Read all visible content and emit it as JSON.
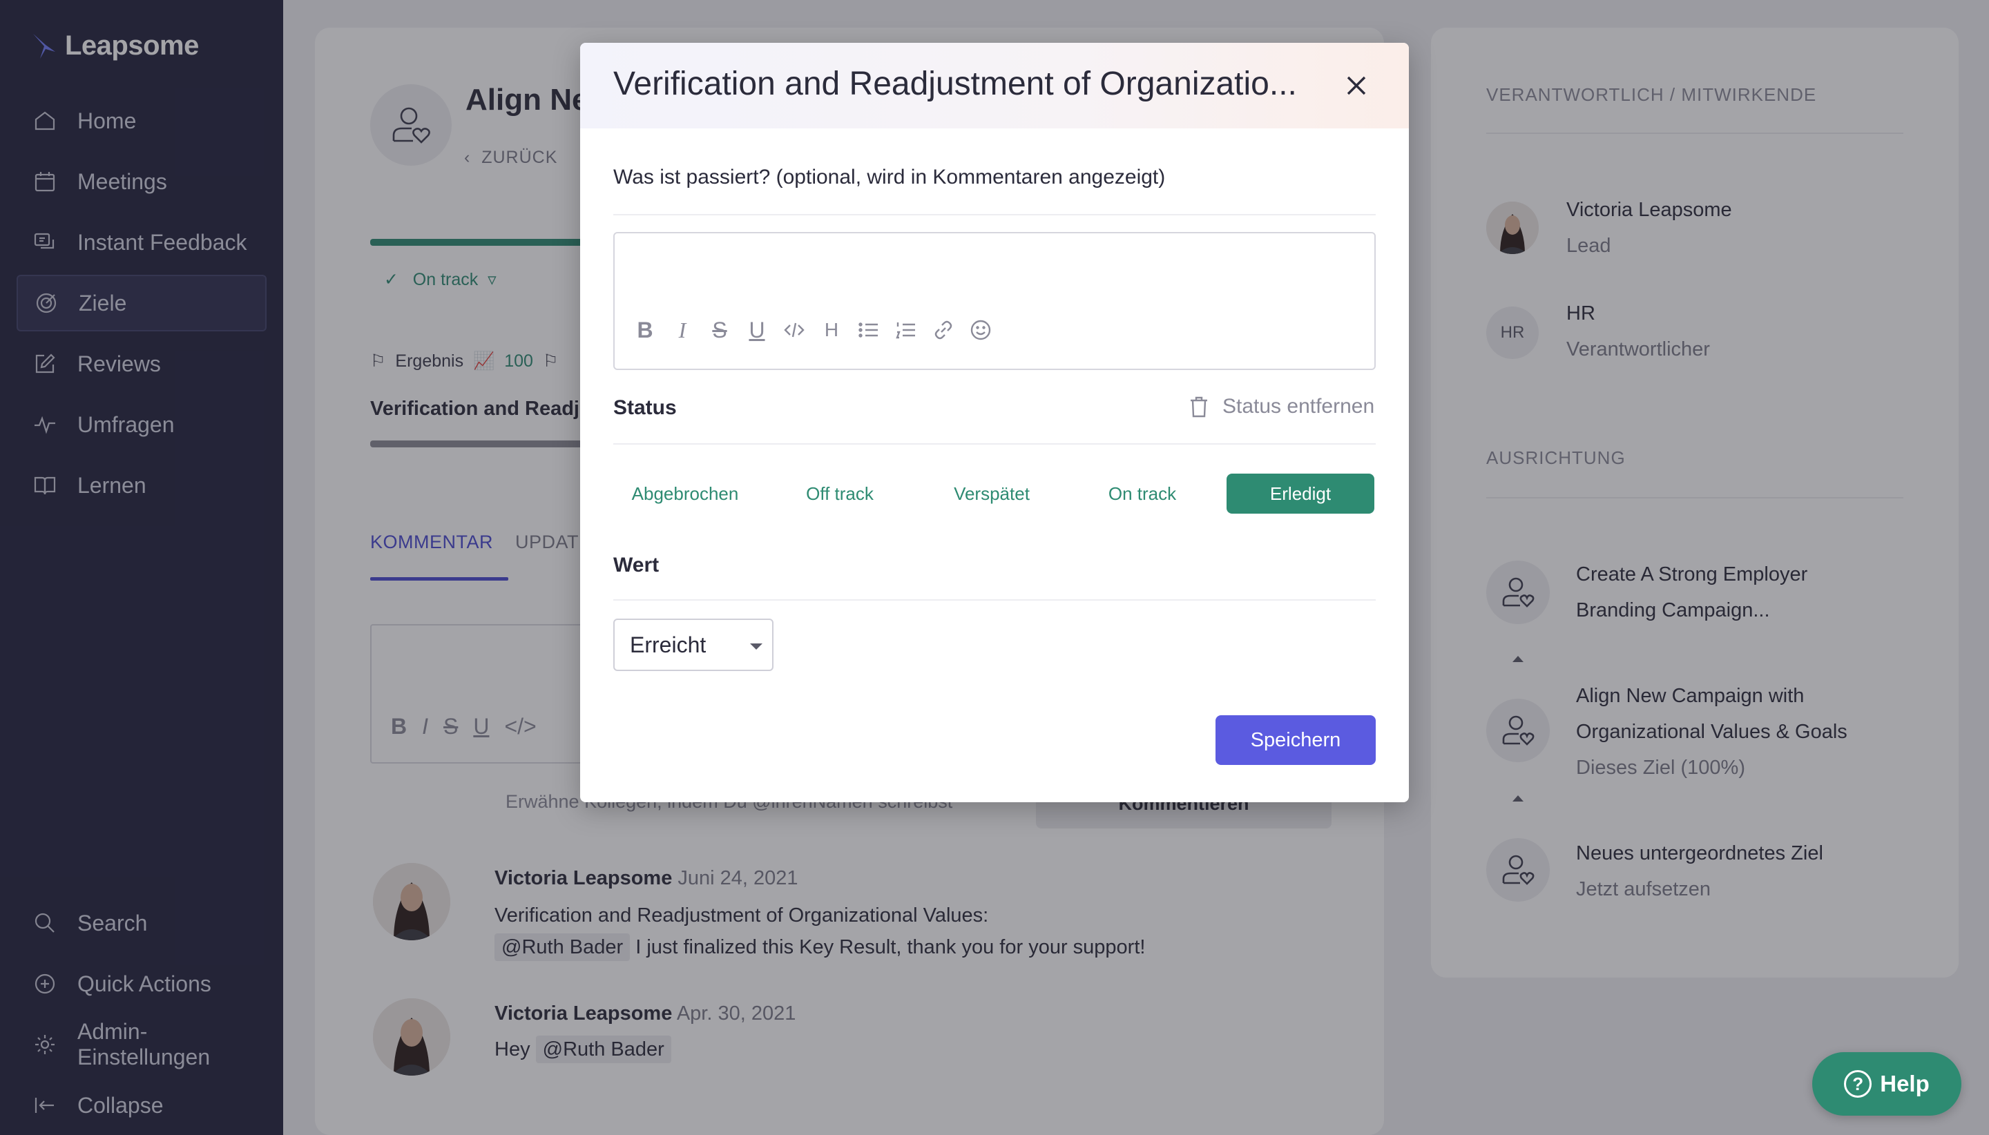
{
  "sidebar": {
    "logo": "Leapsome",
    "nav": [
      {
        "label": "Home",
        "icon": "home-icon"
      },
      {
        "label": "Meetings",
        "icon": "calendar-icon"
      },
      {
        "label": "Instant Feedback",
        "icon": "feedback-icon"
      },
      {
        "label": "Ziele",
        "icon": "target-icon",
        "active": true
      },
      {
        "label": "Reviews",
        "icon": "edit-icon"
      },
      {
        "label": "Umfragen",
        "icon": "pulse-icon"
      },
      {
        "label": "Lernen",
        "icon": "book-icon"
      }
    ],
    "bottom": [
      {
        "label": "Search",
        "icon": "search-icon"
      },
      {
        "label": "Quick Actions",
        "icon": "plus-circle-icon"
      },
      {
        "label": "Admin-Einstellungen",
        "icon": "gear-icon"
      },
      {
        "label": "Collapse",
        "icon": "collapse-icon"
      }
    ]
  },
  "main": {
    "goal_title": "Align Ne",
    "back": "ZURÜCK",
    "status_chip": "On track",
    "ergebnis_label": "Ergebnis",
    "ergebnis_value": "100",
    "kr_title": "Verification and Readju",
    "tabs": {
      "comment": "KOMMENTAR",
      "update": "UPDATE"
    },
    "mention_hint": "Erwähne Kollegen, indem Du @ihrenNamen schreibst",
    "comment_button": "Kommentieren",
    "feed": [
      {
        "author": "Victoria Leapsome",
        "date": "Juni 24, 2021",
        "line1": "Verification and Readjustment of Organizational Values:",
        "mention": "@Ruth Bader",
        "line2": "I just finalized this Key Result, thank you for your support!"
      },
      {
        "author": "Victoria Leapsome",
        "date": "Apr. 30, 2021",
        "prefix": "Hey",
        "mention": "@Ruth Bader"
      }
    ]
  },
  "right": {
    "owners_label": "VERANTWORTLICH / MITWIRKENDE",
    "people": [
      {
        "name": "Victoria Leapsome",
        "role": "Lead"
      },
      {
        "name": "HR",
        "role": "Verantwortlicher",
        "initials": "HR"
      }
    ],
    "alignment_label": "AUSRICHTUNG",
    "alignment": [
      {
        "line1": "Create A Strong Employer",
        "line2": "Branding Campaign..."
      },
      {
        "line1": "Align New Campaign with",
        "line2": "Organizational Values & Goals",
        "sub": "Dieses Ziel (100%)"
      },
      {
        "line1": "Neues untergeordnetes Ziel",
        "sub": "Jetzt aufsetzen"
      }
    ]
  },
  "modal": {
    "title": "Verification and Readjustment of Organizatio...",
    "question": "Was ist passiert? (optional, wird in Kommentaren angezeigt)",
    "status_label": "Status",
    "remove_status": "Status entfernen",
    "status_options": [
      "Abgebrochen",
      "Off track",
      "Verspätet",
      "On track",
      "Erledigt"
    ],
    "selected_status": "Erledigt",
    "value_label": "Wert",
    "value_selected": "Erreicht",
    "save": "Speichern"
  },
  "help": {
    "label": "Help"
  },
  "colors": {
    "sidebar": "#23233d",
    "accent": "#5b5be0",
    "green": "#2e8b72",
    "tab": "#4b4bd1"
  }
}
